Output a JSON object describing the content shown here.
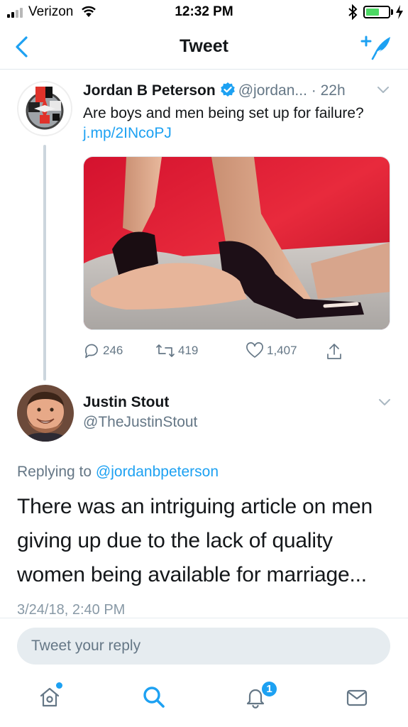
{
  "status_bar": {
    "carrier": "Verizon",
    "time": "12:32 PM"
  },
  "nav": {
    "title": "Tweet",
    "icons": [
      "back-chevron-icon",
      "compose-tweet-icon"
    ]
  },
  "parent_tweet": {
    "author_name": "Jordan B Peterson",
    "verified": true,
    "handle": "@jordan...",
    "time": "· 22h",
    "text": "Are boys and men being set up for failure?",
    "link_text": "j.mp/2INcoPJ",
    "media": "photo-women-stiletto-heels-on-man-hand",
    "stats": {
      "replies": "246",
      "retweets": "419",
      "likes": "1,407"
    }
  },
  "reply_tweet": {
    "author_name": "Justin Stout",
    "handle": "@TheJustinStout",
    "replying_to_prefix": "Replying to",
    "replying_to_handle": "@jordanbpeterson",
    "text": "There was an intriguing article on men giving up due to the lack of quality women being available for marriage...",
    "timestamp": "3/24/18, 2:40 PM"
  },
  "composer": {
    "placeholder": "Tweet your reply"
  },
  "tabbar": {
    "tabs": [
      "home-icon",
      "search-icon",
      "notifications-icon",
      "messages-icon"
    ],
    "notifications_badge": "1"
  },
  "colors": {
    "accent": "#1da1f2",
    "text_primary": "#14171a",
    "text_secondary": "#657786",
    "divider": "#e1e8ed",
    "battery_green": "#4cd964"
  }
}
